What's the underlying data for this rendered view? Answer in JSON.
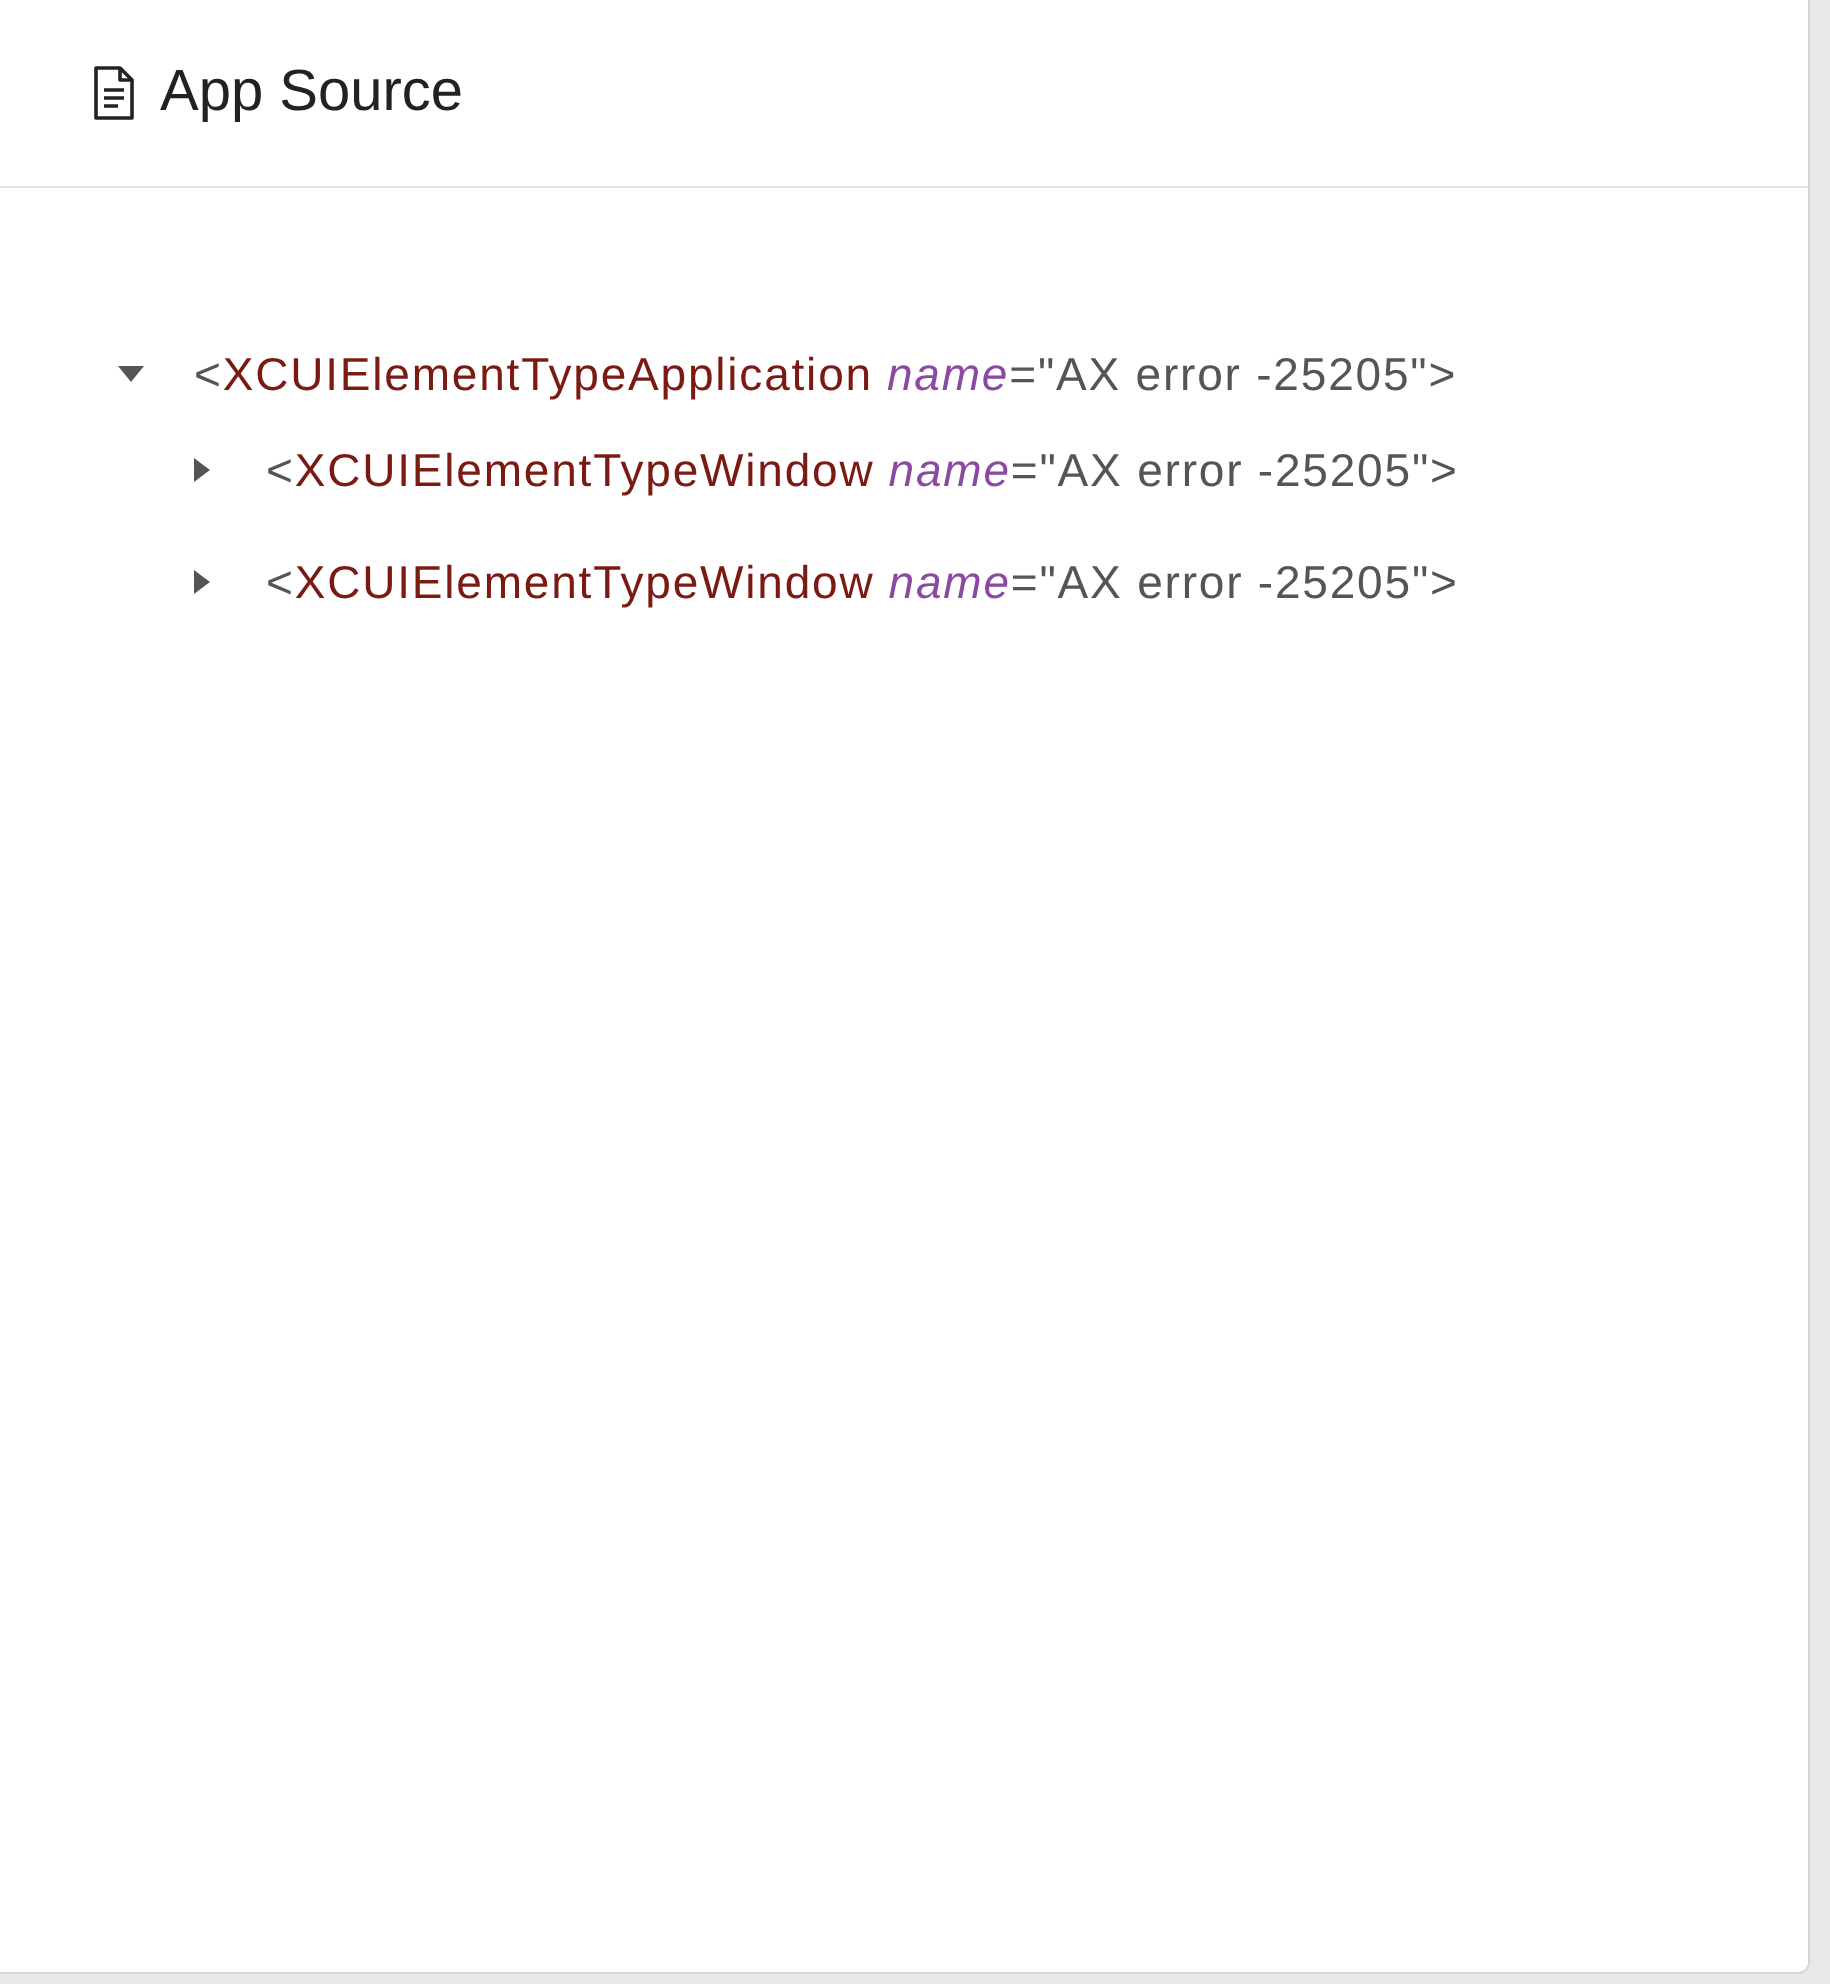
{
  "panel": {
    "title": "App Source"
  },
  "tree": [
    {
      "open_bracket": "<",
      "tag": "XCUIElementTypeApplication",
      "attributes": [
        {
          "name": "name",
          "equals": "=",
          "value": "\"AX error -25205\""
        }
      ],
      "close_bracket": ">",
      "expanded": true,
      "children": [
        {
          "open_bracket": "<",
          "tag": "XCUIElementTypeWindow",
          "attributes": [
            {
              "name": "name",
              "equals": "=",
              "value": "\"AX error -25205\""
            }
          ],
          "close_bracket": ">",
          "expanded": false
        },
        {
          "open_bracket": "<",
          "tag": "XCUIElementTypeWindow",
          "attributes": [
            {
              "name": "name",
              "equals": "=",
              "value": "\"AX error -25205\""
            }
          ],
          "close_bracket": ">",
          "expanded": false
        }
      ]
    }
  ]
}
